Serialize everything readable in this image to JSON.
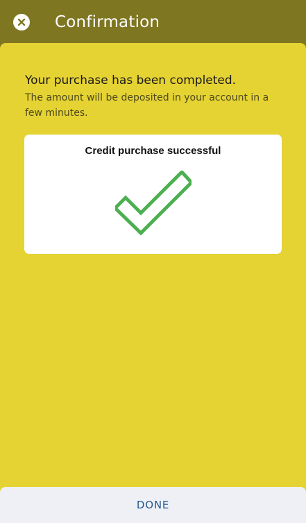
{
  "app_bar": {
    "title": "Confirmation",
    "close_icon": "close-circle-icon"
  },
  "content": {
    "headline": "Your purchase has been completed.",
    "subtext": "The amount will be deposited in your account in a few minutes."
  },
  "card": {
    "title": "Credit purchase successful",
    "icon": "checkmark-icon",
    "icon_color": "#4caf50"
  },
  "footer": {
    "done_label": "DONE"
  },
  "colors": {
    "app_bar": "#7f7622",
    "sheet": "#e5d233",
    "card": "#ffffff",
    "footer": "#eef0f6",
    "done_text": "#23588f"
  }
}
